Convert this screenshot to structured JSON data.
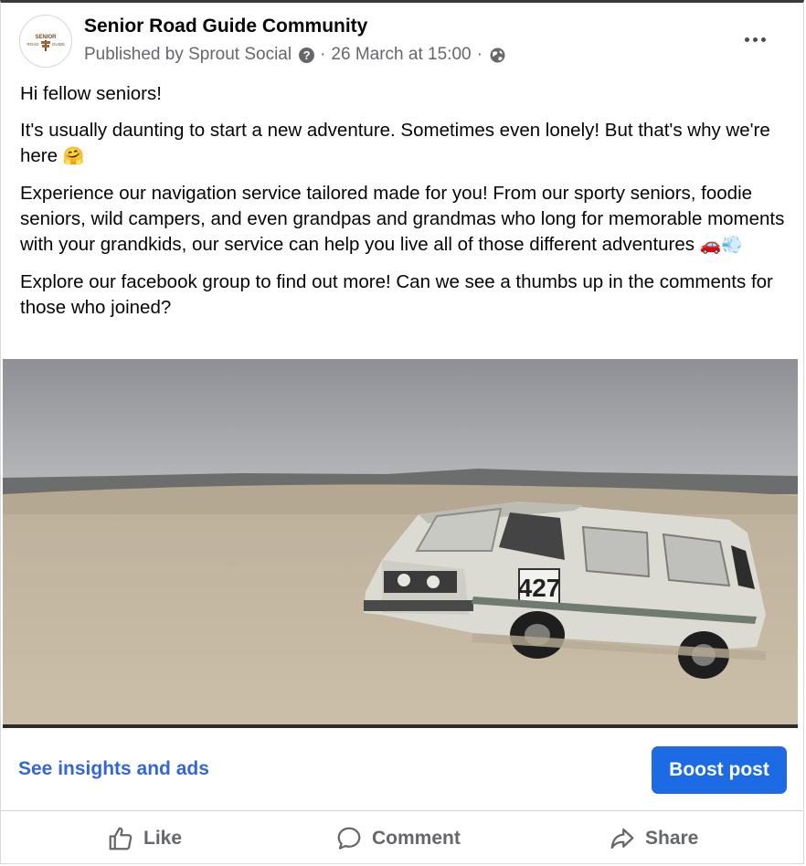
{
  "post": {
    "page_name": "Senior Road Guide Community",
    "avatar_logo_text": [
      "SENIOR",
      "ROAD",
      "GUIDE"
    ],
    "published_by": "Published by Sprout Social",
    "date": "26 March at 15:00",
    "separator": "·",
    "paragraphs": {
      "p1": "Hi fellow seniors!",
      "p2": "It's usually daunting to start a new adventure. Sometimes even lonely! But that's why we're here",
      "p2_emoji": "🤗",
      "p3": "Experience our navigation service tailored made for you! From our sporty seniors, foodie seniors, wild campers, and even grandpas and grandmas who long for memorable moments with your grandkids, our service can help you live all of those different adventures",
      "p3_emoji": "🚗💨",
      "p4": "Explore our facebook group to find out more! Can we see a thumbs up in the comments for those who joined?"
    },
    "image": {
      "description_icon": "van-in-desert-photo",
      "van_number": "427"
    }
  },
  "footer": {
    "insights_label": "See insights and ads",
    "boost_label": "Boost post"
  },
  "actions": {
    "like_label": "Like",
    "comment_label": "Comment",
    "share_label": "Share"
  },
  "colors": {
    "link_blue": "#3466d6",
    "boost_blue": "#1c6ae4",
    "muted_text": "#65676b"
  }
}
